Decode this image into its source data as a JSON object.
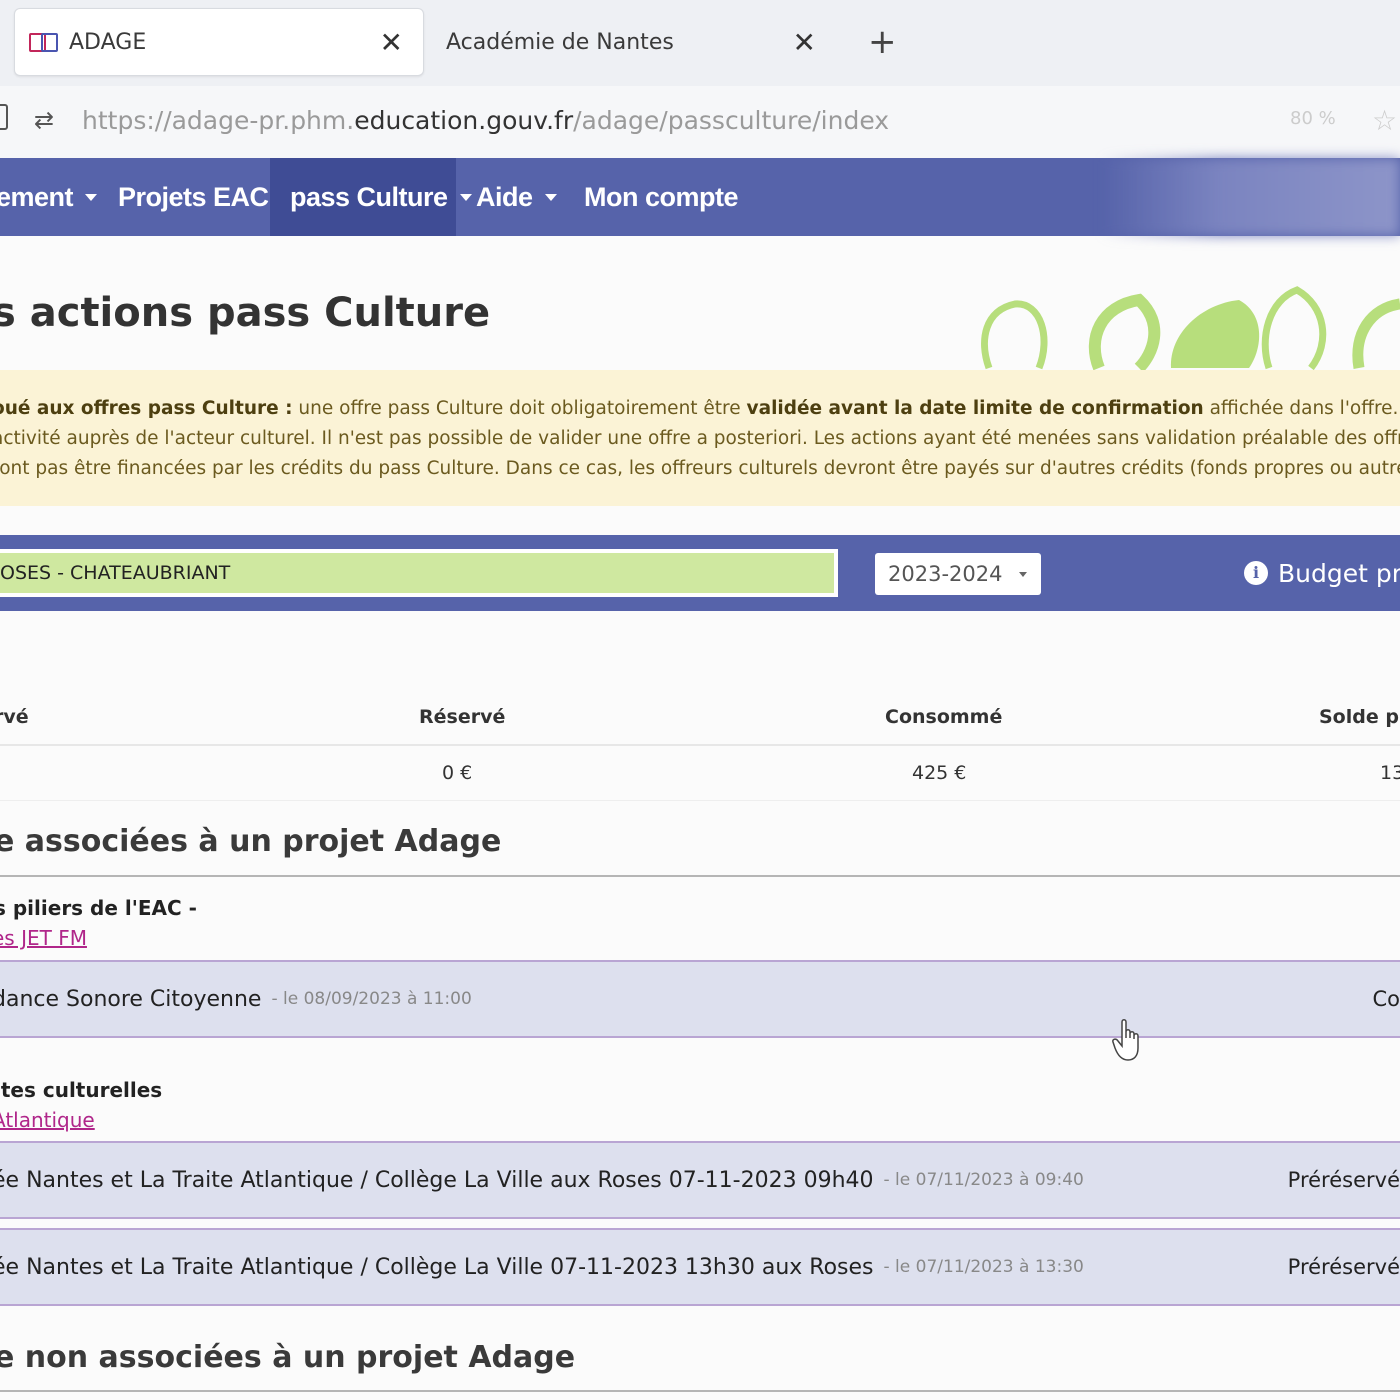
{
  "browser": {
    "tabs": [
      {
        "label": "ADAGE",
        "active": true
      },
      {
        "label": "Académie de Nantes",
        "active": false
      }
    ],
    "url": {
      "prefix": "https://adage-pr.phm.",
      "host": "education.gouv.fr",
      "path": "/adage/passculture/index"
    },
    "zoom": "80 %"
  },
  "nav": {
    "items": [
      {
        "label": "ement",
        "caret": true
      },
      {
        "label": "Projets EAC",
        "caret": true
      },
      {
        "label": "pass Culture",
        "caret": true,
        "active": true
      },
      {
        "label": "Aide",
        "caret": true
      },
      {
        "label": "Mon compte",
        "caret": false
      }
    ]
  },
  "page": {
    "title": "s actions pass Culture"
  },
  "warning": {
    "line1_bold1": "oué aux offres pass Culture :",
    "line1_text1": " une offre pass Culture doit obligatoirement être ",
    "line1_bold2": "validée avant la date limite de confirmation",
    "line1_text2": " affichée dans l'offre. Cette ét",
    "line2": "activité auprès de l'acteur culturel. Il n'est pas possible de valider une offre a posteriori. Les actions ayant été menées sans validation préalable des offres p",
    "line3": "ront pas être financées par les crédits du pass Culture. Dans ce cas, les offreurs culturels devront être payés sur d'autres crédits (fonds propres ou autres su"
  },
  "filters": {
    "school": "OSES - CHATEAUBRIANT",
    "year": "2023-2024",
    "budget_label": "Budget pré"
  },
  "summary": {
    "headers": [
      "rvé",
      "Réservé",
      "Consommé",
      "Solde pr"
    ],
    "values": [
      "",
      "0 €",
      "425 €",
      "13"
    ]
  },
  "sections": [
    {
      "title": "e associées à un projet Adage",
      "groups": [
        {
          "title": "s piliers de l'EAC -",
          "link": "es JET FM",
          "offers": [
            {
              "name": "dance Sonore Citoyenne",
              "date": "- le 08/09/2023 à 11:00",
              "status": "Co"
            }
          ]
        },
        {
          "title": "ites culturelles",
          "link": "Atlantique",
          "offers": [
            {
              "name": "ée Nantes et La Traite Atlantique / Collège La Ville aux Roses 07-11-2023 09h40",
              "date": "- le 07/11/2023 à 09:40",
              "status": "Préréservé"
            },
            {
              "name": "ée Nantes et La Traite Atlantique / Collège La Ville 07-11-2023 13h30 aux Roses",
              "date": "- le 07/11/2023 à 13:30",
              "status": "Préréservé"
            }
          ]
        }
      ]
    },
    {
      "title": "e non associées à un projet Adage"
    }
  ],
  "colors": {
    "nav_bg": "#5663aa",
    "nav_active": "#3f4c95",
    "warning_bg": "#fbf3d6",
    "school_bg": "#cfe8a0",
    "offer_bg": "#dde0ee",
    "link": "#b0268a",
    "deco_green": "#b7de7c"
  },
  "icons": [
    "adage-favicon-icon",
    "close-icon",
    "plus-icon",
    "lock-icon",
    "site-settings-icon",
    "favorite-icon",
    "caret-down-icon",
    "info-icon",
    "hand-cursor-icon"
  ]
}
